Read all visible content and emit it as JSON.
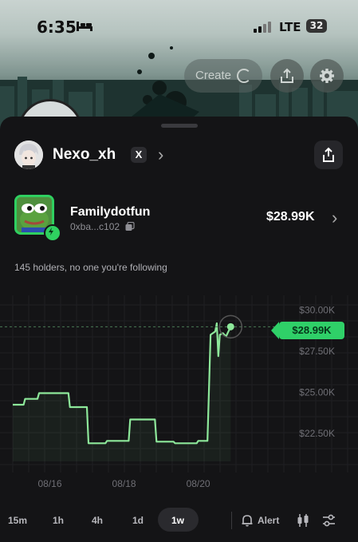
{
  "status_bar": {
    "time": "6:35",
    "network": "LTE",
    "battery": "32"
  },
  "header_actions": {
    "create_label": "Create"
  },
  "user": {
    "name": "Nexo_xh",
    "social_badge": "X"
  },
  "token": {
    "name": "Familydotfun",
    "address": "0xba...c102",
    "market_cap": "$28.99K"
  },
  "holders_text": "145 holders, no one you're following",
  "chart_data": {
    "type": "line",
    "x": [
      "08/15 00:00",
      "08/15 07:00",
      "08/15 08:00",
      "08/15 16:00",
      "08/15 17:00",
      "08/16 12:00",
      "08/16 13:00",
      "08/17 00:00",
      "08/17 01:00",
      "08/17 12:00",
      "08/17 13:00",
      "08/18 03:00",
      "08/18 04:00",
      "08/18 20:00",
      "08/18 21:00",
      "08/19 08:00",
      "08/19 09:00",
      "08/19 23:00",
      "08/20 00:00",
      "08/20 06:00",
      "08/20 08:00",
      "08/20 11:00",
      "08/20 12:00",
      "08/20 13:00",
      "08/20 14:00",
      "08/20 16:00",
      "08/20 18:00",
      "08/20 21:00"
    ],
    "y": [
      24250,
      24250,
      24600,
      24600,
      24950,
      24950,
      24100,
      24100,
      21900,
      21900,
      22050,
      22050,
      23350,
      23350,
      22000,
      22000,
      21900,
      21900,
      22050,
      22050,
      28500,
      28700,
      29200,
      27200,
      28500,
      28600,
      28400,
      28990
    ],
    "current_price_label": "$28.99K",
    "yticks": [
      "$30.00K",
      "$27.50K",
      "$25.00K",
      "$22.50K"
    ],
    "ytick_values": [
      30000,
      27500,
      25000,
      22500
    ],
    "xticks": [
      "08/16",
      "08/18",
      "08/20"
    ],
    "xtick_values": [
      "08/16 00:00",
      "08/18 00:00",
      "08/20 00:00"
    ],
    "ylim": [
      20800,
      30900
    ],
    "xlim": [
      "08/15 00:00",
      "08/21 18:00"
    ],
    "grid": true,
    "line_color": "#8de89a"
  },
  "timeframes": [
    "15m",
    "1h",
    "4h",
    "1d",
    "1w"
  ],
  "active_timeframe": "1w",
  "toolbar": {
    "alert_label": "Alert"
  }
}
